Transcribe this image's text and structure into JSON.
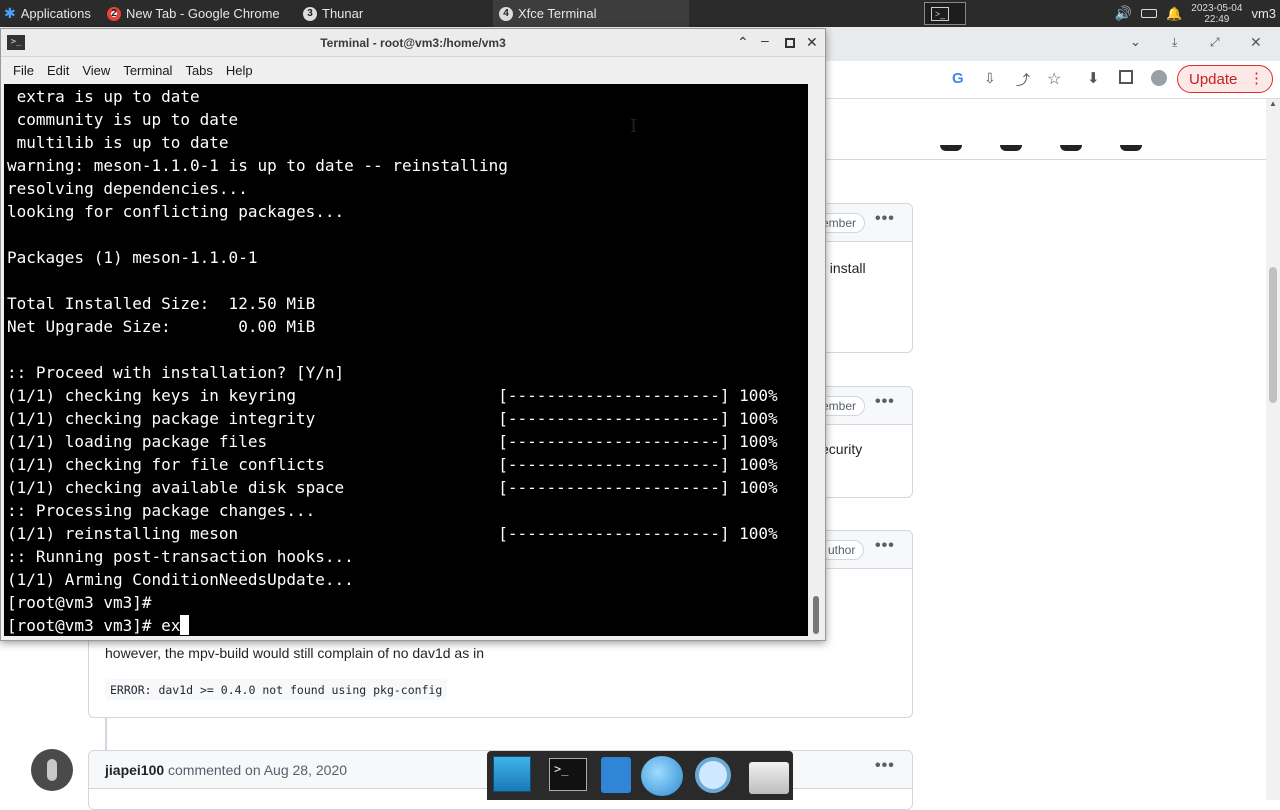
{
  "taskbar": {
    "apps_label": "Applications",
    "tasks": [
      {
        "num": "2",
        "label": "New Tab - Google Chrome"
      },
      {
        "num": "3",
        "label": "Thunar"
      },
      {
        "num": "4",
        "label": "Xfce Terminal"
      }
    ],
    "clock_date": "2023-05-04",
    "clock_time": "22:49",
    "user": "vm3"
  },
  "browser": {
    "update_label": "Update",
    "comments": [
      {
        "badge": "ember",
        "snippet": "al install"
      },
      {
        "badge": "ember",
        "snippet": "ecurity"
      },
      {
        "badge": "uthor"
      }
    ],
    "comment_text": "however, the mpv-build would still complain of no dav1d as in",
    "code_text": "ERROR: dav1d >= 0.4.0 not found using pkg-config",
    "commenter": "jiapei100",
    "commented_on": "commented on Aug 28, 2020"
  },
  "terminal": {
    "title": "Terminal - root@vm3:/home/vm3",
    "menu": [
      "File",
      "Edit",
      "View",
      "Terminal",
      "Tabs",
      "Help"
    ],
    "lines": [
      " extra is up to date",
      " community is up to date",
      " multilib is up to date",
      "warning: meson-1.1.0-1 is up to date -- reinstalling",
      "resolving dependencies...",
      "looking for conflicting packages...",
      "",
      "Packages (1) meson-1.1.0-1",
      "",
      "Total Installed Size:  12.50 MiB",
      "Net Upgrade Size:       0.00 MiB",
      "",
      ":: Proceed with installation? [Y/n]",
      "(1/1) checking keys in keyring                     [----------------------] 100%",
      "(1/1) checking package integrity                   [----------------------] 100%",
      "(1/1) loading package files                        [----------------------] 100%",
      "(1/1) checking for file conflicts                  [----------------------] 100%",
      "(1/1) checking available disk space                [----------------------] 100%",
      ":: Processing package changes...",
      "(1/1) reinstalling meson                           [----------------------] 100%",
      ":: Running post-transaction hooks...",
      "(1/1) Arming ConditionNeedsUpdate...",
      "[root@vm3 vm3]#"
    ],
    "prompt": "[root@vm3 vm3]# ",
    "typed": "ex"
  },
  "colors": {
    "taskbar": "#2b2b2b",
    "terminal_bg": "#000000",
    "update_accent": "#d93025"
  }
}
